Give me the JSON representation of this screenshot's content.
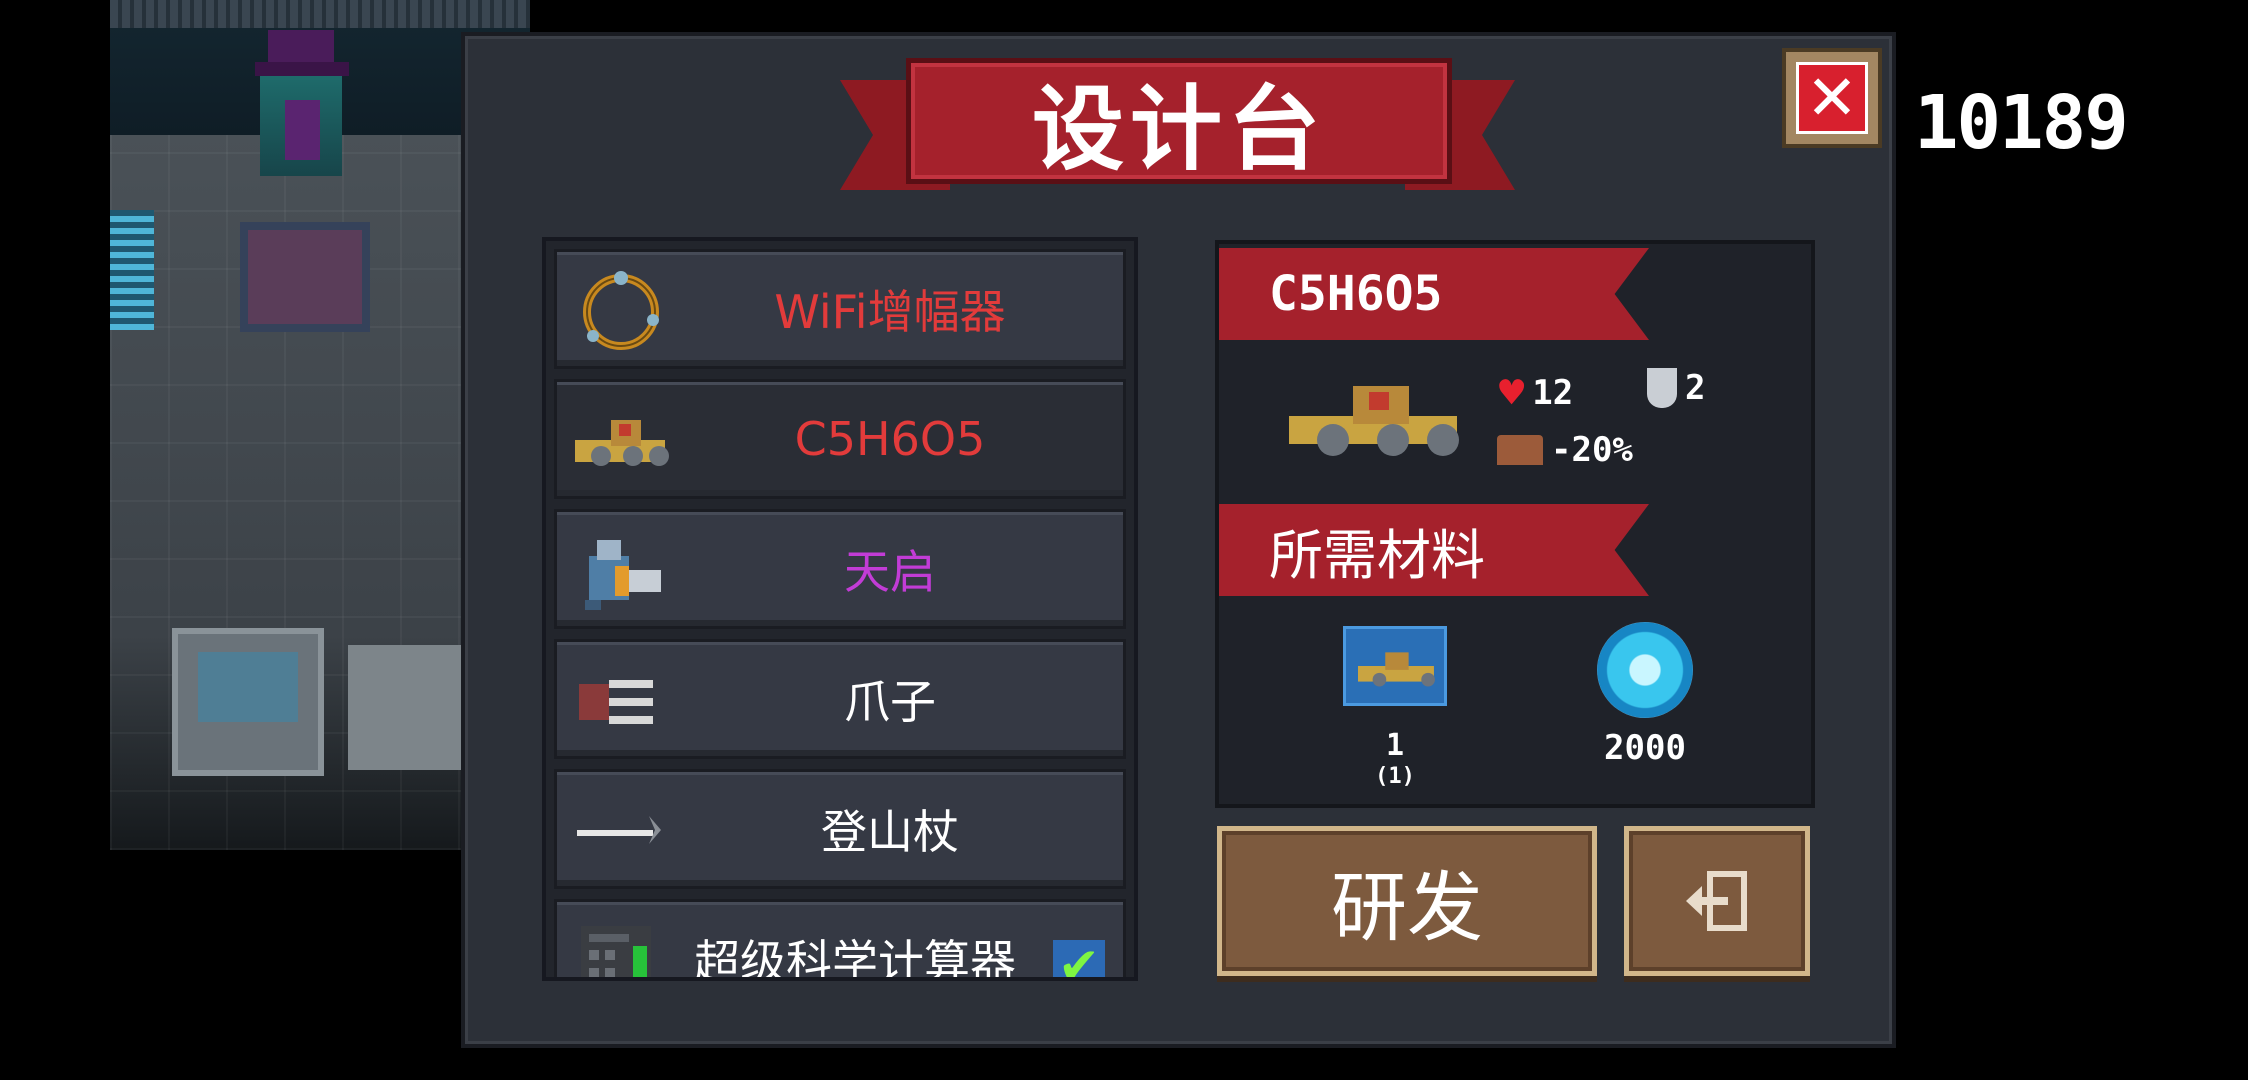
{
  "score": "10189",
  "panel": {
    "title": "设计台",
    "close_icon": "close-icon"
  },
  "items": [
    {
      "label": "WiFi增幅器",
      "color": "#e23b3b",
      "icon": "ring-amplifier-icon",
      "checked": false
    },
    {
      "label": "C5H6O5",
      "color": "#e23b3b",
      "icon": "triple-cannon-icon",
      "checked": false
    },
    {
      "label": "天启",
      "color": "#c23cd6",
      "icon": "mech-robot-icon",
      "checked": false
    },
    {
      "label": "爪子",
      "color": "#ffffff",
      "icon": "claw-icon",
      "checked": false
    },
    {
      "label": "登山杖",
      "color": "#ffffff",
      "icon": "hiking-pick-icon",
      "checked": false
    },
    {
      "label": "超级科学计算器",
      "color": "#ffffff",
      "icon": "calculator-icon",
      "checked": true
    }
  ],
  "detail": {
    "name": "C5H6O5",
    "stats": {
      "health": "12",
      "armor": "2",
      "speed": "-20%"
    },
    "materials_title": "所需材料",
    "materials": [
      {
        "icon": "blueprint-icon",
        "count": "1",
        "owned": "(1)"
      },
      {
        "icon": "gem-icon",
        "count": "2000"
      }
    ]
  },
  "buttons": {
    "research": "研发",
    "exit_icon": "exit-icon"
  },
  "colors": {
    "banner": "#a5212c",
    "panel": "#2c3038",
    "button": "#7d5a3e"
  }
}
